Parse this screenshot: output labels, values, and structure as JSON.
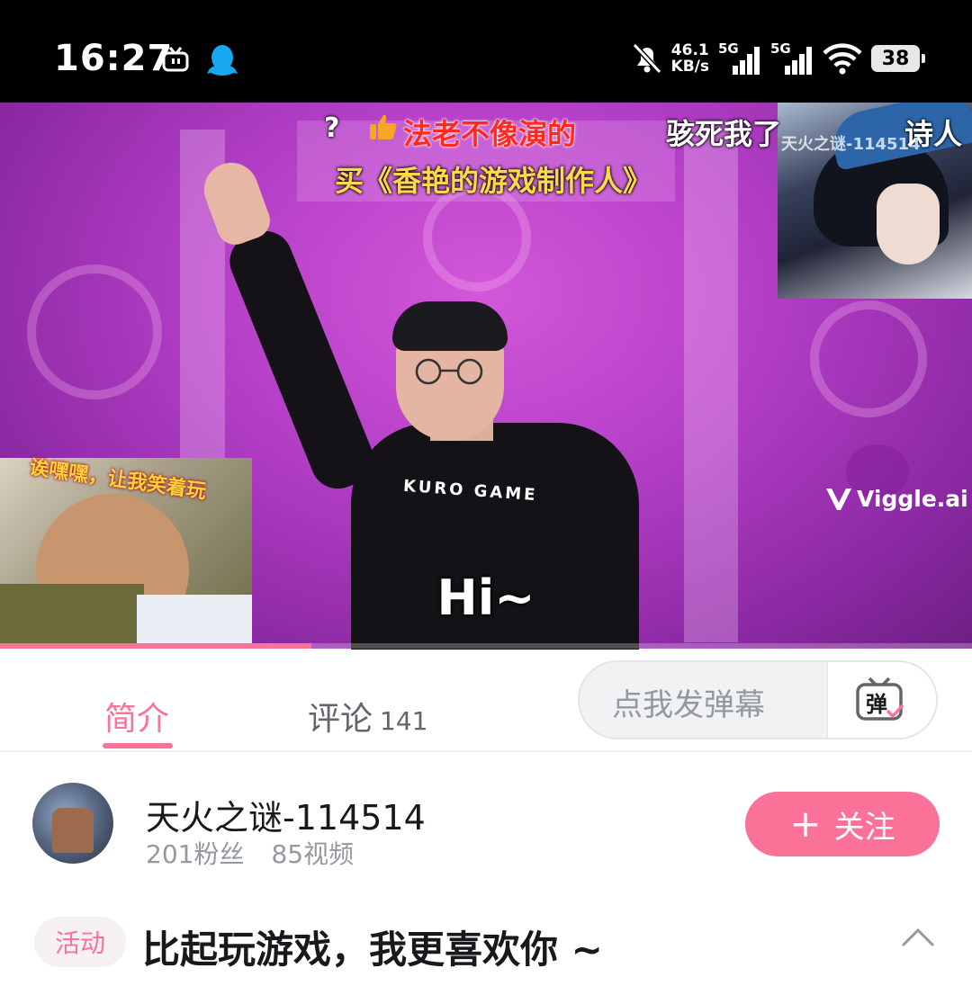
{
  "status_bar": {
    "time": "16:27",
    "speed_value": "46.1",
    "speed_unit": "KB/s",
    "sim1_label": "5G",
    "sim2_label": "5G",
    "battery": "38",
    "icons": [
      "tv-icon",
      "qq-icon",
      "mute-icon",
      "signal-icon",
      "wifi-icon",
      "battery-icon"
    ]
  },
  "video": {
    "danmaku": {
      "question": "?",
      "red": "法老不像演的",
      "white1": "骇死我了",
      "white2": "诗人",
      "yellow": "买《香艳的游戏制作人》"
    },
    "watermark_name": "天火之谜-114514",
    "pip_caption": "诶嘿嘿，让我笑着玩",
    "shirt_text": "KURO GAME",
    "viggle": "Viggle.ai",
    "subtitle": "Hi~",
    "progress": 0.32
  },
  "tabs": {
    "intro": "简介",
    "comments": "评论",
    "comment_count": "141",
    "danmaku_placeholder": "点我发弹幕",
    "danmaku_button_label": "弹"
  },
  "uploader": {
    "name": "天火之谜-114514",
    "followers": "201粉丝",
    "videos": "85视频",
    "follow_label": "关注"
  },
  "title": {
    "tag": "活动",
    "text": "比起玩游戏，我更喜欢你 ~"
  },
  "colors": {
    "accent": "#fb7299",
    "danmaku_red": "#ff2a1f",
    "danmaku_yellow": "#ffd84a"
  }
}
